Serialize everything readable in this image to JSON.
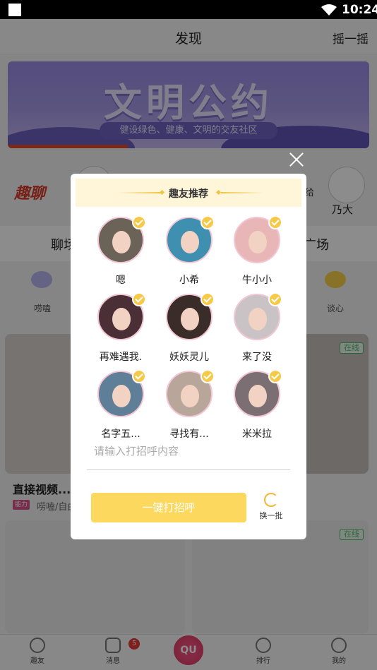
{
  "status_bar": {
    "time": "10:24"
  },
  "header": {
    "title": "发现",
    "shake_label": "摇一摇"
  },
  "banner": {
    "title": "文明公约",
    "slogan": "健设绿色、健康、文明的交友社区"
  },
  "background": {
    "logo_text": "趣聊",
    "username_right": "乃大",
    "partial_text": "给",
    "tab_left": "聊场",
    "tab_right": "广场",
    "cat_left": "唠嗑",
    "cat_right": "谈心",
    "card_title": "直接视频...",
    "card_tag": "能力",
    "card_sub": "唠嗑/自由",
    "online_label": "在线",
    "online_label_2": "在线"
  },
  "bottom_nav": {
    "items": [
      {
        "label": "趣友",
        "icon": "face-icon"
      },
      {
        "label": "消息",
        "icon": "chat-icon"
      },
      {
        "label": "",
        "icon": ""
      },
      {
        "label": "排行",
        "icon": "rank-icon"
      },
      {
        "label": "我的",
        "icon": "user-icon"
      }
    ],
    "center_label": "QU",
    "message_badge": "5"
  },
  "dialog": {
    "title": "趣友推荐",
    "users": [
      {
        "name": "嗯",
        "bg": "#6b6258"
      },
      {
        "name": "小希",
        "bg": "#3f8fb0"
      },
      {
        "name": "牛小小",
        "bg": "#e9b6b8"
      },
      {
        "name": "再难遇我.",
        "bg": "#4a3036"
      },
      {
        "name": "妖妖灵儿",
        "bg": "#3a2c28"
      },
      {
        "name": "来了没",
        "bg": "#c9c3c6"
      },
      {
        "name": "名字五...",
        "bg": "#5f7f98"
      },
      {
        "name": "寻找有...",
        "bg": "#b8a69a"
      },
      {
        "name": "米米拉",
        "bg": "#7b6f74"
      }
    ],
    "greeting_placeholder": "请输入打招呼内容",
    "greet_button": "一键打招呼",
    "refresh_label": "换一批"
  },
  "colors": {
    "accent_yellow": "#fdd85e",
    "check_yellow": "#f7c948",
    "nav_pink": "#e43d6a"
  }
}
